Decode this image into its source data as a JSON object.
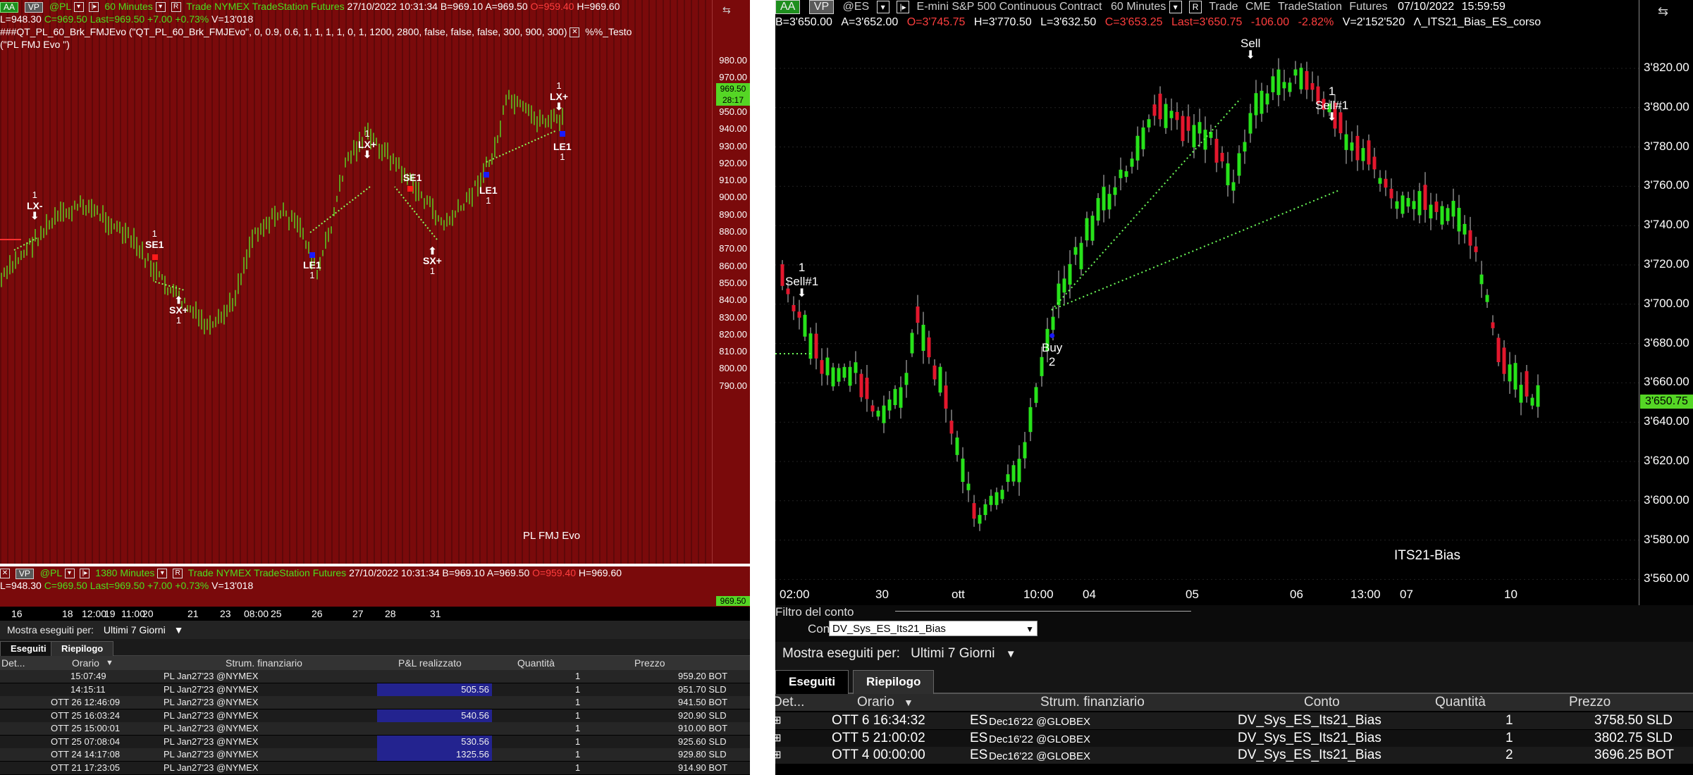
{
  "left": {
    "toolbar": {
      "btn_aa": "AA",
      "btn_vp": "VP",
      "symbol": "@PL",
      "interval": "60 Minutes",
      "mode": "Trade",
      "exchange": "NYMEX",
      "provider": "TradeStation",
      "type": "Futures",
      "date": "27/10/2022",
      "time": "10:31:34",
      "bid": "B=969.10",
      "ask": "A=969.50",
      "open": "O=959.40",
      "high": "H=969.60"
    },
    "quote_line": {
      "low": "L=948.30",
      "close": "C=969.50",
      "last": "Last=969.50",
      "chg": "+7.00",
      "pct": "+0.73%",
      "vol": "V=13'018"
    },
    "study": {
      "line1": "###QT_PL_60_Brk_FMJEvo (\"QT_PL_60_Brk_FMJEvo\", 0, 0.9, 0.6, 1, 1, 1, 1, 0, 1, 1200, 2800, false, false, false, 300, 900, 300)",
      "close_glyph": "✕",
      "extra": "%%_Testo",
      "line2": "(\"PL FMJ Evo \")"
    },
    "chart_label": "PL FMJ Evo",
    "y_ticks": [
      "980.00",
      "970.00",
      "960.00",
      "950.00",
      "940.00",
      "930.00",
      "920.00",
      "910.00",
      "900.00",
      "890.00",
      "880.00",
      "870.00",
      "860.00",
      "850.00",
      "840.00",
      "830.00",
      "820.00",
      "810.00",
      "800.00",
      "790.00"
    ],
    "last_price_badge": "969.50",
    "countdown_badge": "28:17",
    "signals": [
      {
        "label": "LX-",
        "num": "1",
        "arrow": "down"
      },
      {
        "label": "SE1",
        "num": "1",
        "arrow": "none"
      },
      {
        "label": "SX+",
        "num": "1",
        "arrow": "up"
      },
      {
        "label": "LX+",
        "num": "1",
        "arrow": "down"
      },
      {
        "label": "LE1",
        "num": "1",
        "arrow": "none"
      },
      {
        "label": "SE1",
        "num": "1",
        "arrow": "none"
      },
      {
        "label": "SX+",
        "num": "1",
        "arrow": "up"
      },
      {
        "label": "LE1",
        "num": "1",
        "arrow": "none"
      },
      {
        "label": "LX+",
        "num": "1",
        "arrow": "down"
      },
      {
        "label": "LE1",
        "num": "1",
        "arrow": "none"
      }
    ],
    "subchart": {
      "btn_vp": "VP",
      "symbol": "@PL",
      "interval": "1380 Minutes",
      "mode": "Trade",
      "exchange": "NYMEX",
      "provider": "TradeStation",
      "type": "Futures",
      "date": "27/10/2022",
      "time": "10:31:34",
      "bid": "B=969.10",
      "ask": "A=969.50",
      "open": "O=959.40",
      "high": "H=969.60",
      "low": "L=948.30",
      "close": "C=969.50",
      "last": "Last=969.50",
      "chg": "+7.00",
      "pct": "+0.73%",
      "vol": "V=13'018",
      "badge": "969.50"
    },
    "x_labels": [
      "16",
      "18",
      "12:00",
      "19",
      "11:00",
      "20",
      "21",
      "23",
      "08:00",
      "25",
      "26",
      "27",
      "28",
      "31"
    ],
    "filter": {
      "label": "Mostra eseguiti per:",
      "value": "Ultimi 7 Giorni",
      "caret": "▼"
    },
    "tabs": [
      "Eseguiti",
      "Riepilogo"
    ],
    "columns": [
      "Det...",
      "Orario",
      "Strum. finanziario",
      "P&L realizzato",
      "Quantità",
      "Prezzo"
    ],
    "sort_caret": "▼",
    "rows": [
      {
        "time": "15:07:49",
        "instr": "PL Jan27'23 @NYMEX",
        "pnl": "",
        "qty": "1",
        "price": "959.20 BOT"
      },
      {
        "time": "14:15:11",
        "instr": "PL Jan27'23 @NYMEX",
        "pnl": "505.56",
        "qty": "1",
        "price": "951.70 SLD"
      },
      {
        "time": "OTT 26 12:46:09",
        "instr": "PL Jan27'23 @NYMEX",
        "pnl": "",
        "qty": "1",
        "price": "941.50 BOT"
      },
      {
        "time": "OTT 25 16:03:24",
        "instr": "PL Jan27'23 @NYMEX",
        "pnl": "540.56",
        "qty": "1",
        "price": "920.90 SLD"
      },
      {
        "time": "OTT 25 15:00:01",
        "instr": "PL Jan27'23 @NYMEX",
        "pnl": "",
        "qty": "1",
        "price": "910.00 BOT"
      },
      {
        "time": "OTT 25 07:08:04",
        "instr": "PL Jan27'23 @NYMEX",
        "pnl": "530.56",
        "qty": "1",
        "price": "925.60 SLD"
      },
      {
        "time": "OTT 24 14:17:08",
        "instr": "PL Jan27'23 @NYMEX",
        "pnl": "1325.56",
        "qty": "1",
        "price": "929.80 SLD"
      },
      {
        "time": "OTT 21 17:23:05",
        "instr": "PL Jan27'23 @NYMEX",
        "pnl": "",
        "qty": "1",
        "price": "914.90 BOT"
      }
    ]
  },
  "right": {
    "quote_line": {
      "bid": "B=3'650.00",
      "ask": "A=3'652.00",
      "open": "O=3'745.75",
      "high": "H=3'770.50",
      "low": "L=3'632.50",
      "close": "C=3'653.25",
      "last": "Last=3'650.75",
      "chg": "-106.00",
      "pct": "-2.82%",
      "vol": "V=2'152'520",
      "strategy": "Λ_ITS21_Bias_ES_corso"
    },
    "toolbar": {
      "btn_aa": "AA",
      "btn_vp": "VP",
      "symbol": "@ES",
      "name": "E-mini S&P 500 Continuous Contract",
      "interval": "60 Minutes",
      "mode": "Trade",
      "exchange": "CME",
      "provider": "TradeStation",
      "type": "Futures",
      "date": "07/10/2022",
      "time": "15:59:59"
    },
    "y_ticks": [
      "3'820.00",
      "3'800.00",
      "3'780.00",
      "3'760.00",
      "3'740.00",
      "3'720.00",
      "3'700.00",
      "3'680.00",
      "3'660.00",
      "3'640.00",
      "3'620.00",
      "3'600.00",
      "3'580.00",
      "3'560.00"
    ],
    "last_price_badge": "3'650.75",
    "chart_label": "ITS21-Bias",
    "signals": [
      {
        "label": "Sell#1",
        "num": "1"
      },
      {
        "label": "Buy",
        "num": "2"
      },
      {
        "label": "Sell",
        "num": ""
      },
      {
        "label": "Sell#1",
        "num": "1"
      }
    ],
    "x_labels": [
      "02:00",
      "30",
      "ott",
      "10:00",
      "04",
      "05",
      "06",
      "13:00",
      "07",
      "10"
    ],
    "account_filter": {
      "title": "Filtro del conto",
      "label": "Conto:",
      "value": "DV_Sys_ES_Its21_Bias",
      "caret": "▼"
    },
    "filter": {
      "label": "Mostra eseguiti per:",
      "value": "Ultimi 7 Giorni",
      "caret": "▼"
    },
    "tabs": [
      "Eseguiti",
      "Riepilogo"
    ],
    "columns": [
      "Det...",
      "Orario",
      "Strum. finanziario",
      "Conto",
      "Quantità",
      "Prezzo"
    ],
    "sort_caret": "▼",
    "row_glyph": "⊞",
    "rows": [
      {
        "time": "OTT 6 16:34:32",
        "sym": "ES",
        "contract": "Dec16'22 @GLOBEX",
        "acct": "DV_Sys_ES_Its21_Bias",
        "qty": "1",
        "price": "3758.50 SLD"
      },
      {
        "time": "OTT 5 21:00:02",
        "sym": "ES",
        "contract": "Dec16'22 @GLOBEX",
        "acct": "DV_Sys_ES_Its21_Bias",
        "qty": "1",
        "price": "3802.75 SLD"
      },
      {
        "time": "OTT 4 00:00:00",
        "sym": "ES",
        "contract": "Dec16'22 @GLOBEX",
        "acct": "DV_Sys_ES_Its21_Bias",
        "qty": "2",
        "price": "3696.25 BOT"
      }
    ]
  }
}
